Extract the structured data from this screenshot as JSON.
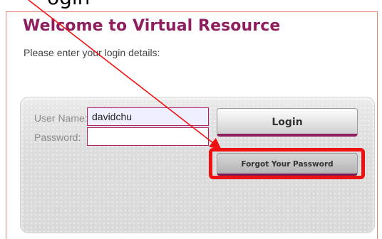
{
  "top_caption": "ogin",
  "page": {
    "title": "Welcome to Virtual Resource",
    "subtitle": "Please enter your login details:"
  },
  "form": {
    "username_label": "User Name:",
    "username_value": "davidchu",
    "password_label": "Password:",
    "password_value": ""
  },
  "buttons": {
    "login": "Login",
    "forgot": "Forgot Your Password"
  },
  "colors": {
    "brand": "#8e1e5e",
    "annotation": "#ee1111"
  }
}
